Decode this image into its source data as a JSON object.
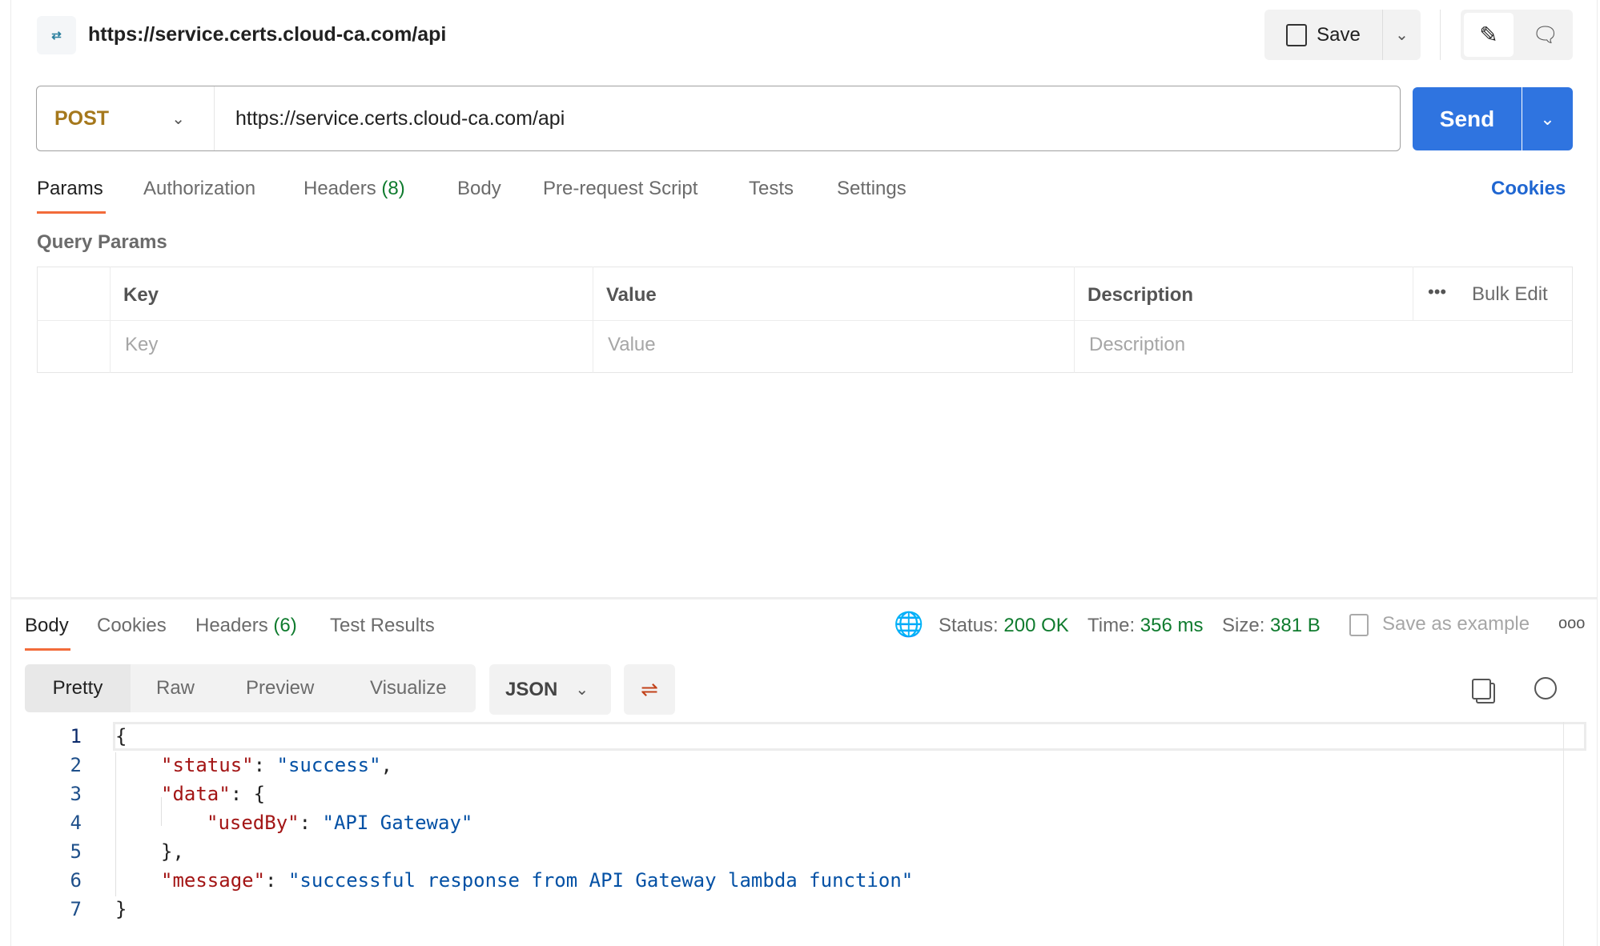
{
  "header": {
    "title": "https://service.certs.cloud-ca.com/api",
    "icon": "http-icon",
    "save_label": "Save"
  },
  "request": {
    "method": "POST",
    "url": "https://service.certs.cloud-ca.com/api",
    "send_label": "Send",
    "method_color": "#a5781c",
    "send_color": "#2f74e0"
  },
  "tabs": [
    {
      "label": "Params"
    },
    {
      "label": "Authorization"
    },
    {
      "label": "Headers",
      "count": "(8)"
    },
    {
      "label": "Body"
    },
    {
      "label": "Pre-request Script"
    },
    {
      "label": "Tests"
    },
    {
      "label": "Settings"
    }
  ],
  "cookies_link": "Cookies",
  "query_params": {
    "title": "Query Params",
    "columns": [
      "Key",
      "Value",
      "Description"
    ],
    "bulk_edit": "Bulk Edit",
    "placeholders": [
      "Key",
      "Value",
      "Description"
    ]
  },
  "response": {
    "tabs": [
      {
        "label": "Body"
      },
      {
        "label": "Cookies"
      },
      {
        "label": "Headers",
        "count": "(6)"
      },
      {
        "label": "Test Results"
      }
    ],
    "status_label": "Status:",
    "status": "200 OK",
    "time_label": "Time:",
    "time": "356 ms",
    "size_label": "Size:",
    "size": "381 B",
    "save_example": "Save as example",
    "views": [
      "Pretty",
      "Raw",
      "Preview",
      "Visualize"
    ],
    "format": "JSON",
    "lines": [
      {
        "n": "1",
        "text": "{"
      },
      {
        "n": "2",
        "key": "\"status\"",
        "sep": ": ",
        "val": "\"success\"",
        "end": ","
      },
      {
        "n": "3",
        "key": "\"data\"",
        "sep": ": {"
      },
      {
        "n": "4",
        "key": "\"usedBy\"",
        "sep": ": ",
        "val": "\"API Gateway\""
      },
      {
        "n": "5",
        "text": "},"
      },
      {
        "n": "6",
        "key": "\"message\"",
        "sep": ": ",
        "val": "\"successful response from API Gateway lambda function\""
      },
      {
        "n": "7",
        "text": "}"
      }
    ]
  }
}
